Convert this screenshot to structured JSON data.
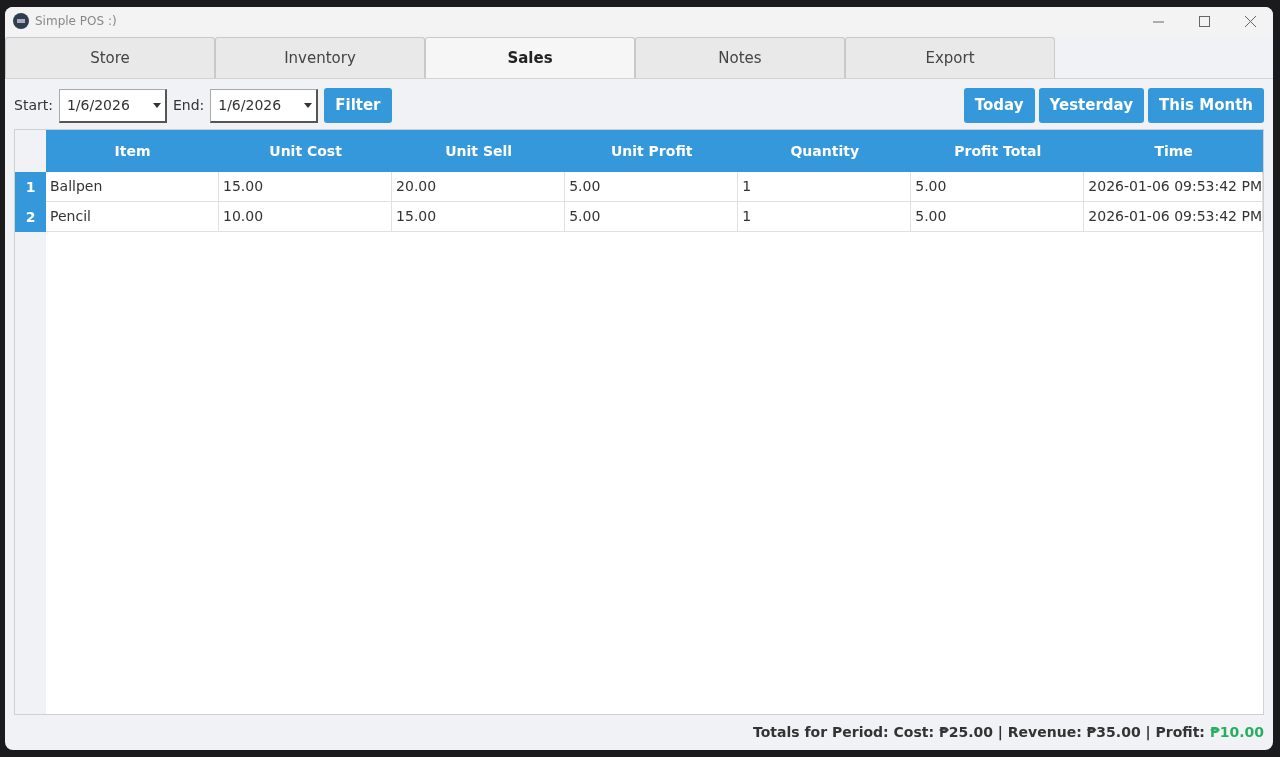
{
  "window": {
    "title": "Simple POS :)"
  },
  "tabs": [
    {
      "label": "Store",
      "selected": false
    },
    {
      "label": "Inventory",
      "selected": false
    },
    {
      "label": "Sales",
      "selected": true
    },
    {
      "label": "Notes",
      "selected": false
    },
    {
      "label": "Export",
      "selected": false
    }
  ],
  "filter": {
    "start_label": "Start:",
    "start_value": "1/6/2026",
    "end_label": "End:",
    "end_value": "1/6/2026",
    "filter_button": "Filter"
  },
  "quick_buttons": [
    "Today",
    "Yesterday",
    "This Month"
  ],
  "table": {
    "columns": [
      "Item",
      "Unit Cost",
      "Unit Sell",
      "Unit Profit",
      "Quantity",
      "Profit Total",
      "Time"
    ],
    "rows": [
      {
        "number": "1",
        "cells": [
          "Ballpen",
          "15.00",
          "20.00",
          "5.00",
          "1",
          "5.00",
          "2026-01-06 09:53:42 PM"
        ]
      },
      {
        "number": "2",
        "cells": [
          "Pencil",
          "10.00",
          "15.00",
          "5.00",
          "1",
          "5.00",
          "2026-01-06 09:53:42 PM"
        ]
      }
    ]
  },
  "status_bar": {
    "totals": "Totals for Period: Cost: ₱25.00 | Revenue: ₱35.00 | Profit:",
    "profit": "₱10.00"
  }
}
